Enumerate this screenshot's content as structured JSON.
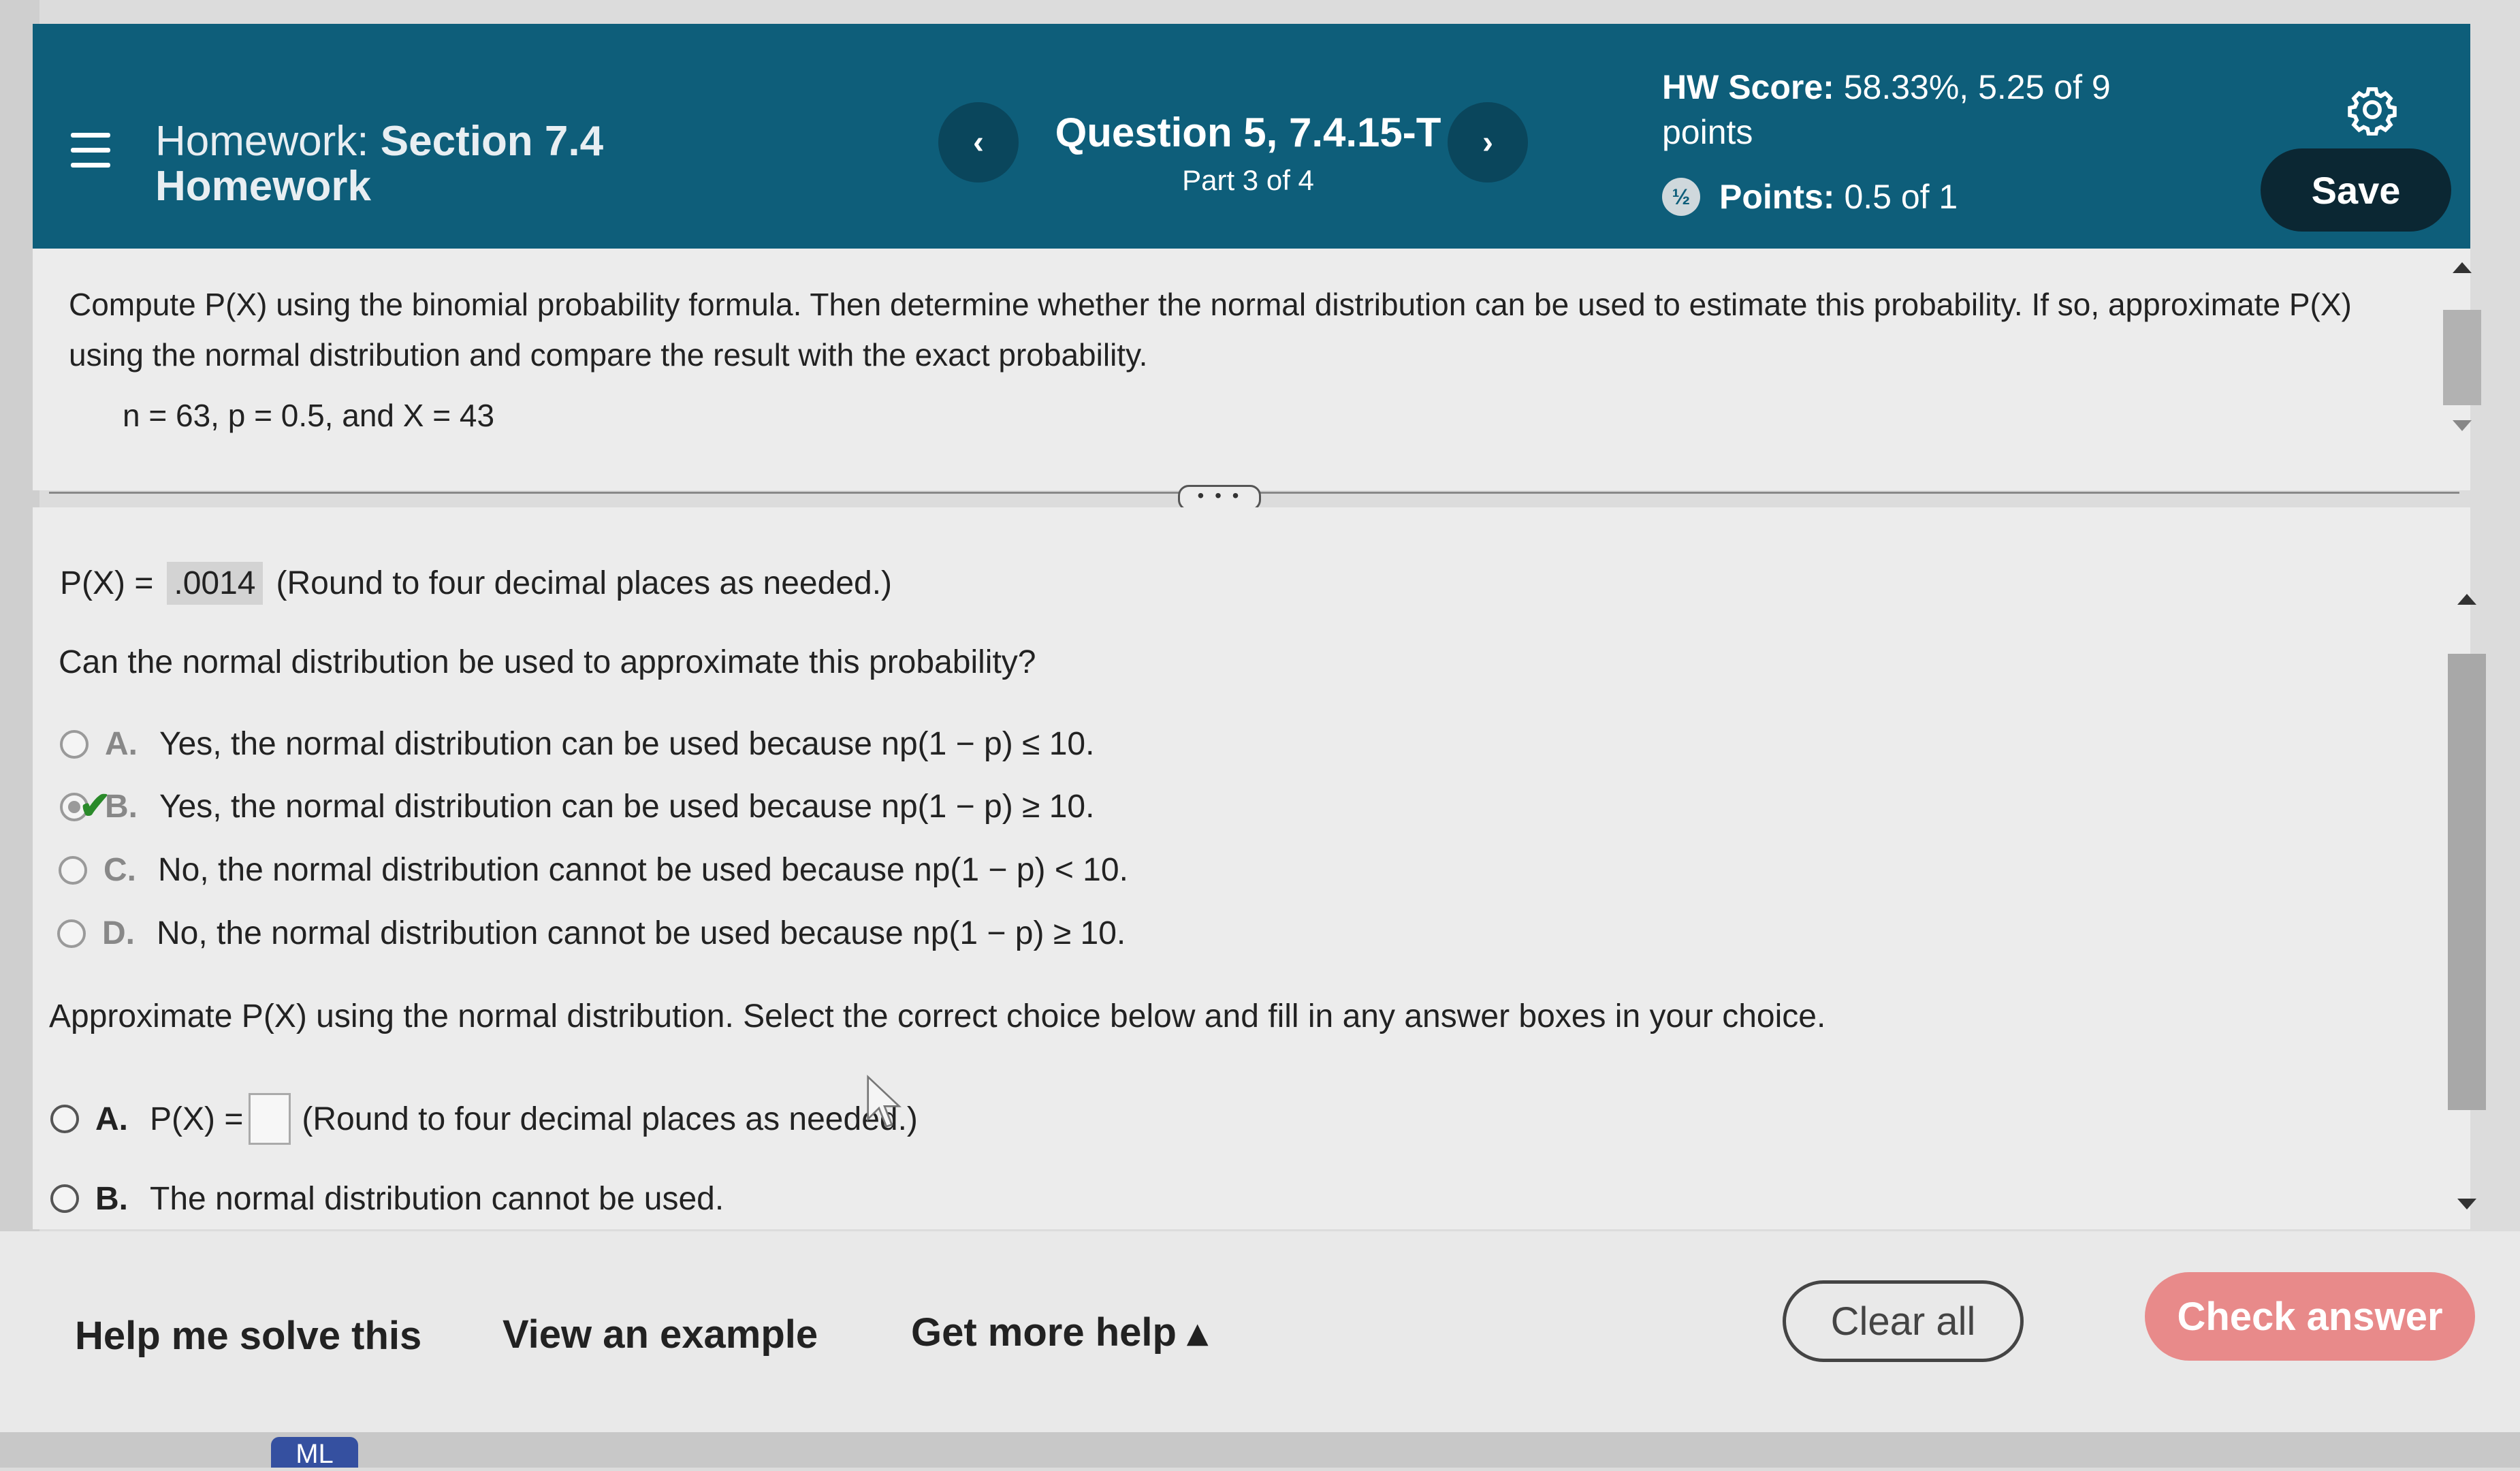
{
  "header": {
    "title_prefix": "Homework:",
    "title_line1_bold": "Section 7.4",
    "title_line2": "Homework",
    "prev_symbol": "‹",
    "next_symbol": "›",
    "question": "Question 5, 7.4.15-T",
    "part": "Part 3 of 4",
    "hw_score_label": "HW Score:",
    "hw_score_value": "58.33%, 5.25 of 9",
    "hw_score_line2": "points",
    "points_icon_text": "½",
    "points_label": "Points:",
    "points_value": "0.5 of 1",
    "save_label": "Save",
    "accent_color": "#0e5e7a"
  },
  "problem": {
    "text": "Compute P(X) using the binomial probability formula. Then determine whether the normal distribution can be used to estimate this probability. If so, approximate P(X) using the normal distribution and compare the result with the exact probability.",
    "given": "n = 63, p = 0.5, and X = 43",
    "expand_label": "• • •"
  },
  "answer": {
    "px_label": "P(X) =",
    "px_value": ".0014",
    "px_hint": "(Round to four decimal places as needed.)",
    "question2": "Can the normal distribution be used to approximate this probability?",
    "options": [
      {
        "letter": "A.",
        "text": "Yes, the normal distribution can be used because np(1 − p) ≤ 10."
      },
      {
        "letter": "B.",
        "text": "Yes, the normal distribution can be used because np(1 − p) ≥ 10."
      },
      {
        "letter": "C.",
        "text": "No, the normal distribution cannot be used because np(1 − p) < 10."
      },
      {
        "letter": "D.",
        "text": "No, the normal distribution cannot be used because np(1 − p) ≥ 10."
      }
    ],
    "selected_option": "B.",
    "check_symbol": "✔",
    "question3": "Approximate P(X) using the normal distribution. Select the correct choice below and fill in any answer boxes in your choice.",
    "approx_options": [
      {
        "letter": "A.",
        "prefix": "P(X) =",
        "hint": "(Round to four decimal places as needed.)"
      },
      {
        "letter": "B.",
        "text": "The normal distribution cannot be used."
      }
    ]
  },
  "footer": {
    "help_me_solve": "Help me solve this",
    "view_example": "View an example",
    "get_more_help": "Get more help ▴",
    "clear_all": "Clear all",
    "check_answer": "Check answer",
    "check_color": "#e88a8a"
  },
  "taskbar": {
    "ml_label": "ML"
  }
}
